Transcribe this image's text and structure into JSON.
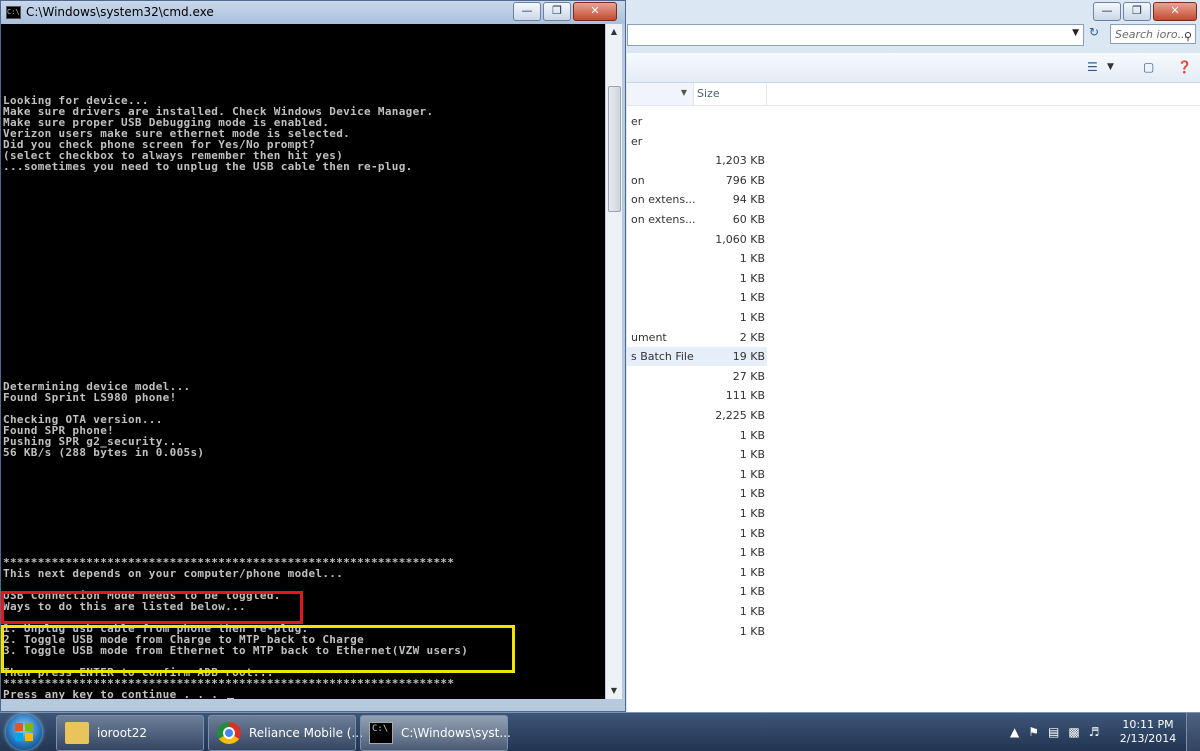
{
  "cmd": {
    "title": "C:\\Windows\\system32\\cmd.exe",
    "icon_text": "C:\\",
    "lines": [
      {
        "row": 7,
        "text": "Looking for device..."
      },
      {
        "row": 8,
        "text": "Make sure drivers are installed. Check Windows Device Manager."
      },
      {
        "row": 9,
        "text": "Make sure proper USB Debugging mode is enabled."
      },
      {
        "row": 10,
        "text": "Verizon users make sure ethernet mode is selected."
      },
      {
        "row": 11,
        "text": "Did you check phone screen for Yes/No prompt?"
      },
      {
        "row": 12,
        "text": "(select checkbox to always remember then hit yes)"
      },
      {
        "row": 13,
        "text": "...sometimes you need to unplug the USB cable then re-plug."
      },
      {
        "row": 33,
        "text": "Determining device model..."
      },
      {
        "row": 34,
        "text": "Found Sprint LS980 phone!"
      },
      {
        "row": 36,
        "text": "Checking OTA version..."
      },
      {
        "row": 37,
        "text": "Found SPR phone!"
      },
      {
        "row": 38,
        "text": "Pushing SPR g2_security..."
      },
      {
        "row": 39,
        "text": "56 KB/s (288 bytes in 0.005s)"
      },
      {
        "row": 49,
        "text": "*****************************************************************"
      },
      {
        "row": 50,
        "text": "This next depends on your computer/phone model..."
      },
      {
        "row": 52,
        "text": "USB Connection Mode needs to be toggled."
      },
      {
        "row": 53,
        "text": "Ways to do this are listed below..."
      },
      {
        "row": 55,
        "text": "1. Unplug usb cable from phone then re-plug."
      },
      {
        "row": 56,
        "text": "2. Toggle USB mode from Charge to MTP back to Charge"
      },
      {
        "row": 57,
        "text": "3. Toggle USB mode from Ethernet to MTP back to Ethernet(VZW users)"
      },
      {
        "row": 59,
        "text": "Then press ENTER to confirm ADB root..."
      },
      {
        "row": 60,
        "text": "*****************************************************************"
      },
      {
        "row": 61,
        "text": "Press any key to continue . . . "
      }
    ]
  },
  "explorer": {
    "search_placeholder": "Search ioro...",
    "size_header": "Size",
    "rows": [
      {
        "type": "er",
        "size": ""
      },
      {
        "type": "er",
        "size": ""
      },
      {
        "type": "",
        "size": "1,203 KB"
      },
      {
        "type": "on",
        "size": "796 KB"
      },
      {
        "type": "on extens...",
        "size": "94 KB"
      },
      {
        "type": "on extens...",
        "size": "60 KB"
      },
      {
        "type": "",
        "size": "1,060 KB"
      },
      {
        "type": "",
        "size": "1 KB"
      },
      {
        "type": "",
        "size": "1 KB"
      },
      {
        "type": "",
        "size": "1 KB"
      },
      {
        "type": "",
        "size": "1 KB"
      },
      {
        "type": "ument",
        "size": "2 KB"
      },
      {
        "type": "s Batch File",
        "size": "19 KB",
        "selected": true
      },
      {
        "type": "",
        "size": "27 KB"
      },
      {
        "type": "",
        "size": "111 KB"
      },
      {
        "type": "",
        "size": "2,225 KB"
      },
      {
        "type": "",
        "size": "1 KB"
      },
      {
        "type": "",
        "size": "1 KB"
      },
      {
        "type": "",
        "size": "1 KB"
      },
      {
        "type": "",
        "size": "1 KB"
      },
      {
        "type": "",
        "size": "1 KB"
      },
      {
        "type": "",
        "size": "1 KB"
      },
      {
        "type": "",
        "size": "1 KB"
      },
      {
        "type": "",
        "size": "1 KB"
      },
      {
        "type": "",
        "size": "1 KB"
      },
      {
        "type": "",
        "size": "1 KB"
      },
      {
        "type": "",
        "size": "1 KB"
      }
    ]
  },
  "taskbar": {
    "items": [
      {
        "label": "ioroot22",
        "icon": "folder-icon"
      },
      {
        "label": "Reliance Mobile (...",
        "icon": "chrome-icon"
      },
      {
        "label": "C:\\Windows\\syst...",
        "icon": "cmd-icon"
      }
    ],
    "clock_time": "10:11 PM",
    "clock_date": "2/13/2014"
  },
  "colors": {
    "highlight_red": "#e3151d",
    "highlight_yellow": "#f2e400",
    "console_text": "#c0c0c0"
  }
}
